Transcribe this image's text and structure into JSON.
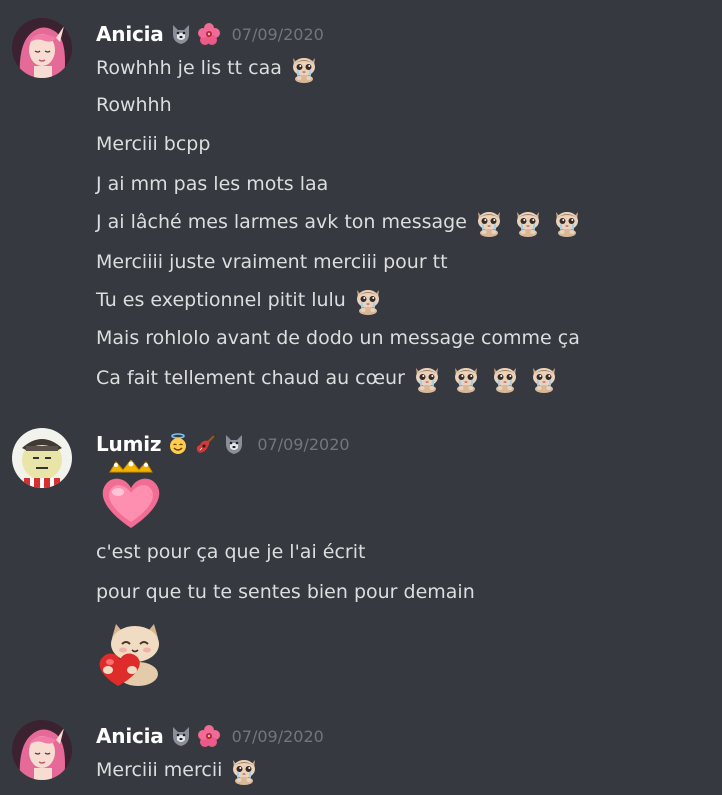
{
  "groups": [
    {
      "author": "Anicia",
      "author_color": "#ffffff",
      "badges": [
        "wolf-emoji",
        "hibiscus-emoji"
      ],
      "timestamp": "07/09/2020",
      "messages": [
        {
          "text": "Rowhhh je lis tt caa",
          "emojis": [
            "crying-cat-emoji"
          ]
        },
        {
          "text": "Rowhhh",
          "emojis": []
        },
        {
          "text": "Merciii bcpp",
          "emojis": []
        },
        {
          "text": "J ai mm pas les mots laa",
          "emojis": []
        },
        {
          "text": "J ai lâché mes larmes avk ton message",
          "emojis": [
            "crying-cat-emoji",
            "crying-cat-emoji",
            "crying-cat-emoji"
          ]
        },
        {
          "text": "Merciiii juste vraiment merciii pour tt",
          "emojis": []
        },
        {
          "text": "Tu es exeptionnel pitit lulu",
          "emojis": [
            "crying-cat-emoji"
          ]
        },
        {
          "text": "Mais rohlolo avant de dodo un message comme ça",
          "emojis": []
        },
        {
          "text": "Ca fait tellement chaud au cœur",
          "emojis": [
            "crying-cat-emoji",
            "crying-cat-emoji",
            "crying-cat-emoji",
            "crying-cat-emoji"
          ]
        }
      ]
    },
    {
      "author": "Lumiz",
      "author_color": "#ffffff",
      "badges": [
        "angel-face-emoji",
        "guitar-emoji",
        "wolf-emoji"
      ],
      "timestamp": "07/09/2020",
      "messages": [
        {
          "text": "",
          "big_emoji": "crowned-heart-emoji"
        },
        {
          "text": "c'est pour ça que je l'ai écrit"
        },
        {
          "text": "pour que tu te sentes bien pour demain"
        },
        {
          "text": "",
          "big_emoji": "cat-holding-heart-emoji"
        }
      ]
    },
    {
      "author": "Anicia",
      "author_color": "#ffffff",
      "badges": [
        "wolf-emoji",
        "hibiscus-emoji"
      ],
      "timestamp": "07/09/2020",
      "messages": [
        {
          "text": "Merciii mercii",
          "emojis": [
            "crying-cat-emoji"
          ]
        }
      ]
    }
  ],
  "colors": {
    "background": "#36393f",
    "message_text": "#dcddde",
    "timestamp": "#72767d"
  }
}
